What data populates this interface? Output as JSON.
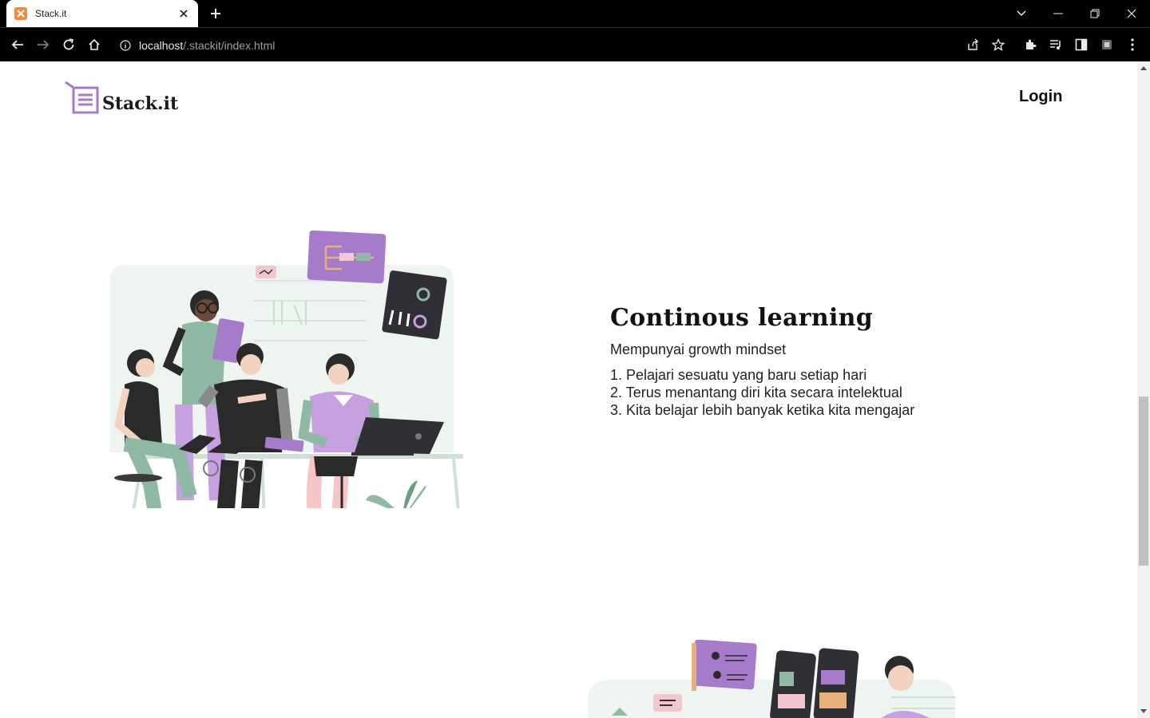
{
  "browser": {
    "tab_title": "Stack.it",
    "url_host": "localhost",
    "url_path": "/.stackit/index.html"
  },
  "header": {
    "logo_text": "Stack.it",
    "login_label": "Login"
  },
  "section": {
    "heading": "Continous learning",
    "subtitle": "Mempunyai growth mindset",
    "items": [
      "1. Pelajari sesuatu yang baru setiap hari",
      "2. Terus menantang diri kita secara intelektual",
      "3. Kita belajar lebih banyak ketika kita mengajar"
    ]
  },
  "colors": {
    "brand_purple": "#a67bc9",
    "sage_green": "#8fb9a4",
    "chrome_dark": "#000000"
  },
  "icons": [
    "back-icon",
    "forward-icon",
    "reload-icon",
    "home-icon",
    "info-icon",
    "share-icon",
    "star-icon",
    "extensions-icon",
    "media-icon",
    "sidepanel-icon",
    "profile-icon",
    "menu-icon"
  ]
}
